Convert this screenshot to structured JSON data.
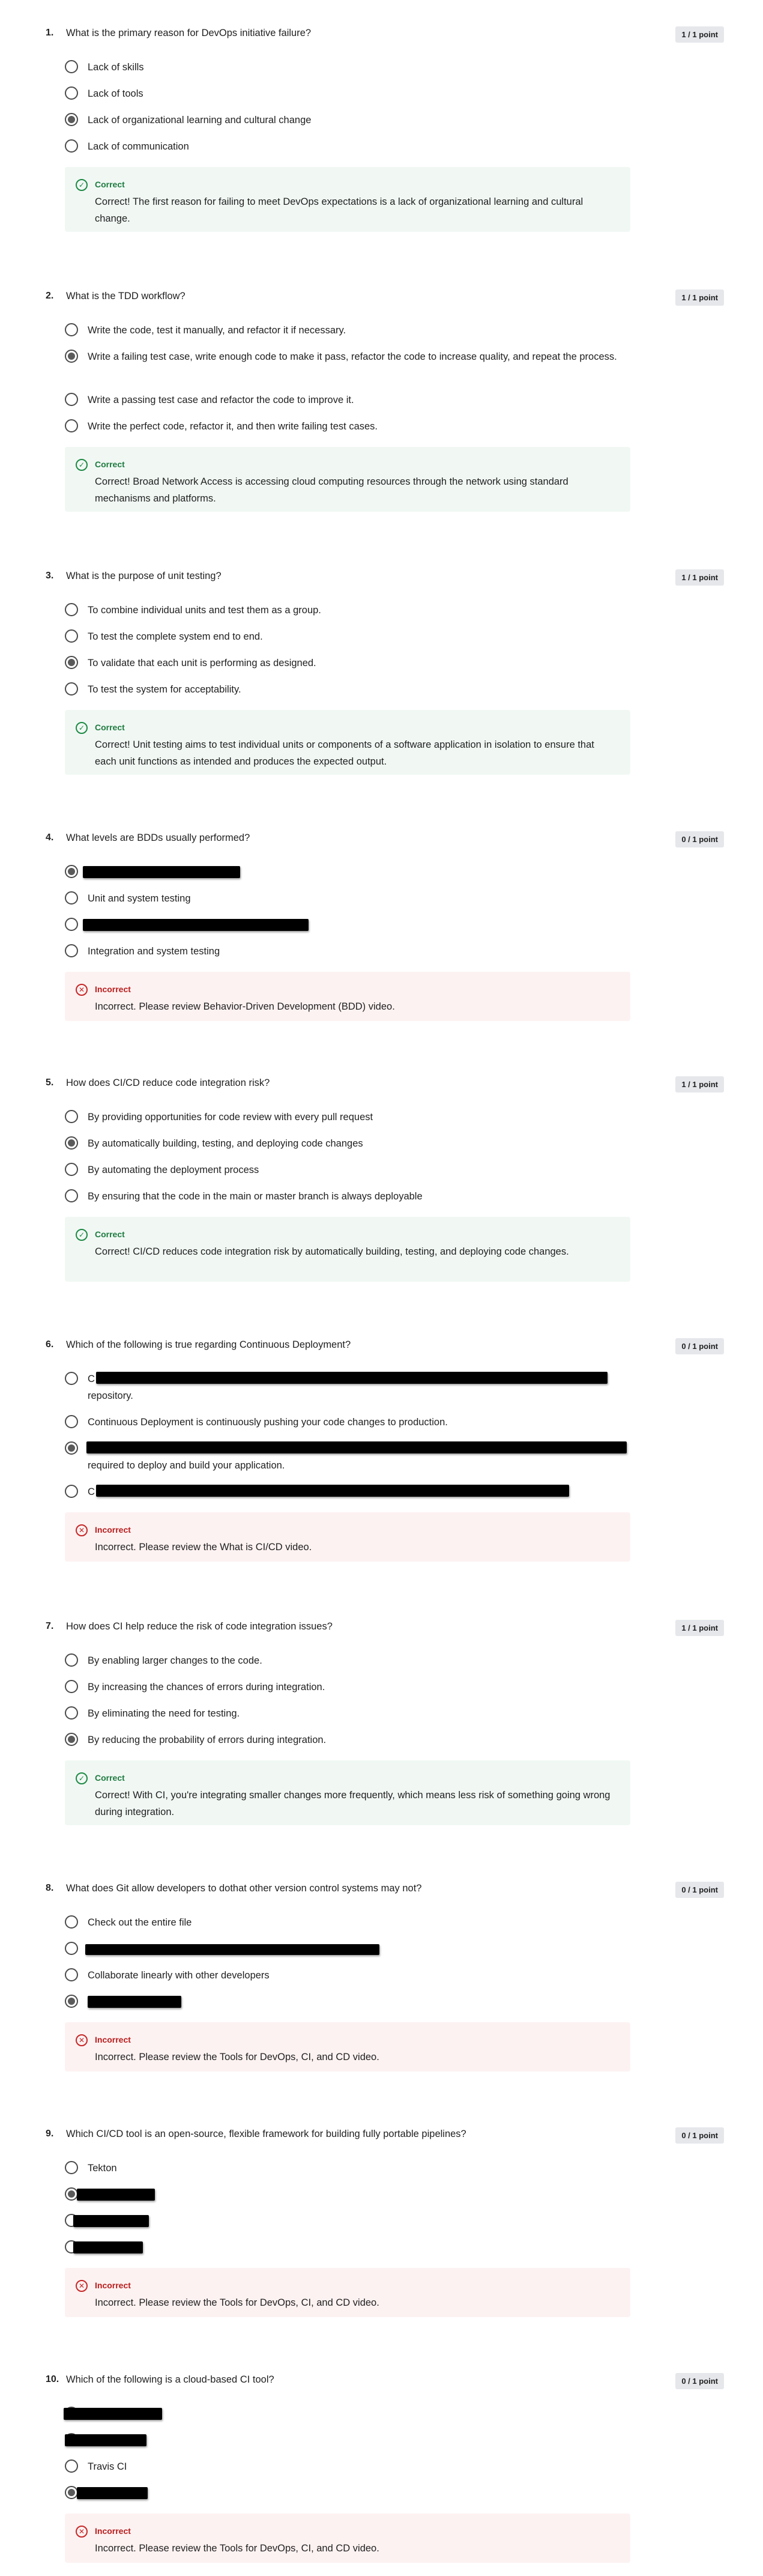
{
  "questions": [
    {
      "number": "1.",
      "text": "What is the primary reason for DevOps initiative failure?",
      "points": "1 / 1 point",
      "options": [
        "Lack of skills",
        "Lack of tools",
        "Lack of organizational learning and cultural change",
        "Lack of communication"
      ],
      "feedback_title": "Correct",
      "feedback_text": "Correct! The first reason for failing to meet DevOps expectations is a lack of organizational learning and cultural change."
    },
    {
      "number": "2.",
      "text": "What is the TDD workflow?",
      "points": "1 / 1 point",
      "options": [
        "Write the code, test it manually, and refactor it if necessary.",
        "Write a failing test case, write enough code to make it pass, refactor the code to increase quality, and repeat the process.",
        "Write a passing test case and refactor the code to improve it.",
        "Write the perfect code, refactor it, and then write failing test cases."
      ],
      "feedback_title": "Correct",
      "feedback_text": "Correct! Broad Network Access is accessing cloud computing resources through the network using standard mechanisms and platforms."
    },
    {
      "number": "3.",
      "text": "What is the purpose of unit testing?",
      "points": "1 / 1 point",
      "options": [
        "To combine individual units and test them as a group.",
        "To test the complete system end to end.",
        "To validate that each unit is performing as designed.",
        "To test the system for acceptability."
      ],
      "feedback_title": "Correct",
      "feedback_text": "Correct! Unit testing aims to test individual units or components of a software application in isolation to ensure that each unit functions as intended and produces the expected output."
    },
    {
      "number": "4.",
      "text": "What levels are BDDs usually performed?",
      "points": "0 / 1 point",
      "options": [
        "Unit and system testing",
        "Integration and system testing"
      ],
      "feedback_title": "Incorrect",
      "feedback_text": "Incorrect. Please review Behavior-Driven Development (BDD) video."
    },
    {
      "number": "5.",
      "text": "How does CI/CD reduce code integration risk?",
      "points": "1 / 1 point",
      "options": [
        "By providing opportunities for code review with every pull request",
        "By automatically building, testing, and deploying code changes",
        "By automating the deployment process",
        "By ensuring that the code in the main or master branch is always deployable"
      ],
      "feedback_title": "Correct",
      "feedback_text": "Correct! CI/CD reduces code integration risk by automatically building, testing, and deploying code changes."
    },
    {
      "number": "6.",
      "text": "Which of the following is true regarding Continuous Deployment?",
      "points": "0 / 1 point",
      "options": [
        "C",
        "repository.",
        "Continuous Deployment is continuously pushing your code changes to production.",
        "required to deploy and build your application.",
        "C"
      ],
      "feedback_title": "Incorrect",
      "feedback_text": "Incorrect. Please review the What is CI/CD video."
    },
    {
      "number": "7.",
      "text": "How does CI help reduce the risk of code integration issues?",
      "points": "1 / 1 point",
      "options": [
        "By enabling larger changes to the code.",
        "By increasing the chances of errors during integration.",
        "By eliminating the need for testing.",
        "By reducing the probability of errors during integration."
      ],
      "feedback_title": "Correct",
      "feedback_text": "Correct! With CI, you're integrating smaller changes more frequently, which means less risk of something going wrong during integration."
    },
    {
      "number": "8.",
      "text": "What does Git allow developers to dothat other version control systems may not?",
      "points": "0 / 1 point",
      "options": [
        "Check out the entire file",
        "Collaborate linearly with other developers"
      ],
      "feedback_title": "Incorrect",
      "feedback_text": "Incorrect. Please review the Tools for DevOps, CI, and CD video."
    },
    {
      "number": "9.",
      "text": "Which CI/CD tool is an open-source, flexible framework for building fully portable pipelines?",
      "points": "0 / 1 point",
      "options": [
        "Tekton"
      ],
      "feedback_title": "Incorrect",
      "feedback_text": "Incorrect. Please review the Tools for DevOps, CI, and CD video."
    },
    {
      "number": "10.",
      "text": "Which of the following is a cloud-based CI tool?",
      "points": "0 / 1 point",
      "options": [
        "Travis CI"
      ],
      "feedback_title": "Incorrect",
      "feedback_text": "Incorrect. Please review the Tools for DevOps, CI, and CD video."
    }
  ]
}
